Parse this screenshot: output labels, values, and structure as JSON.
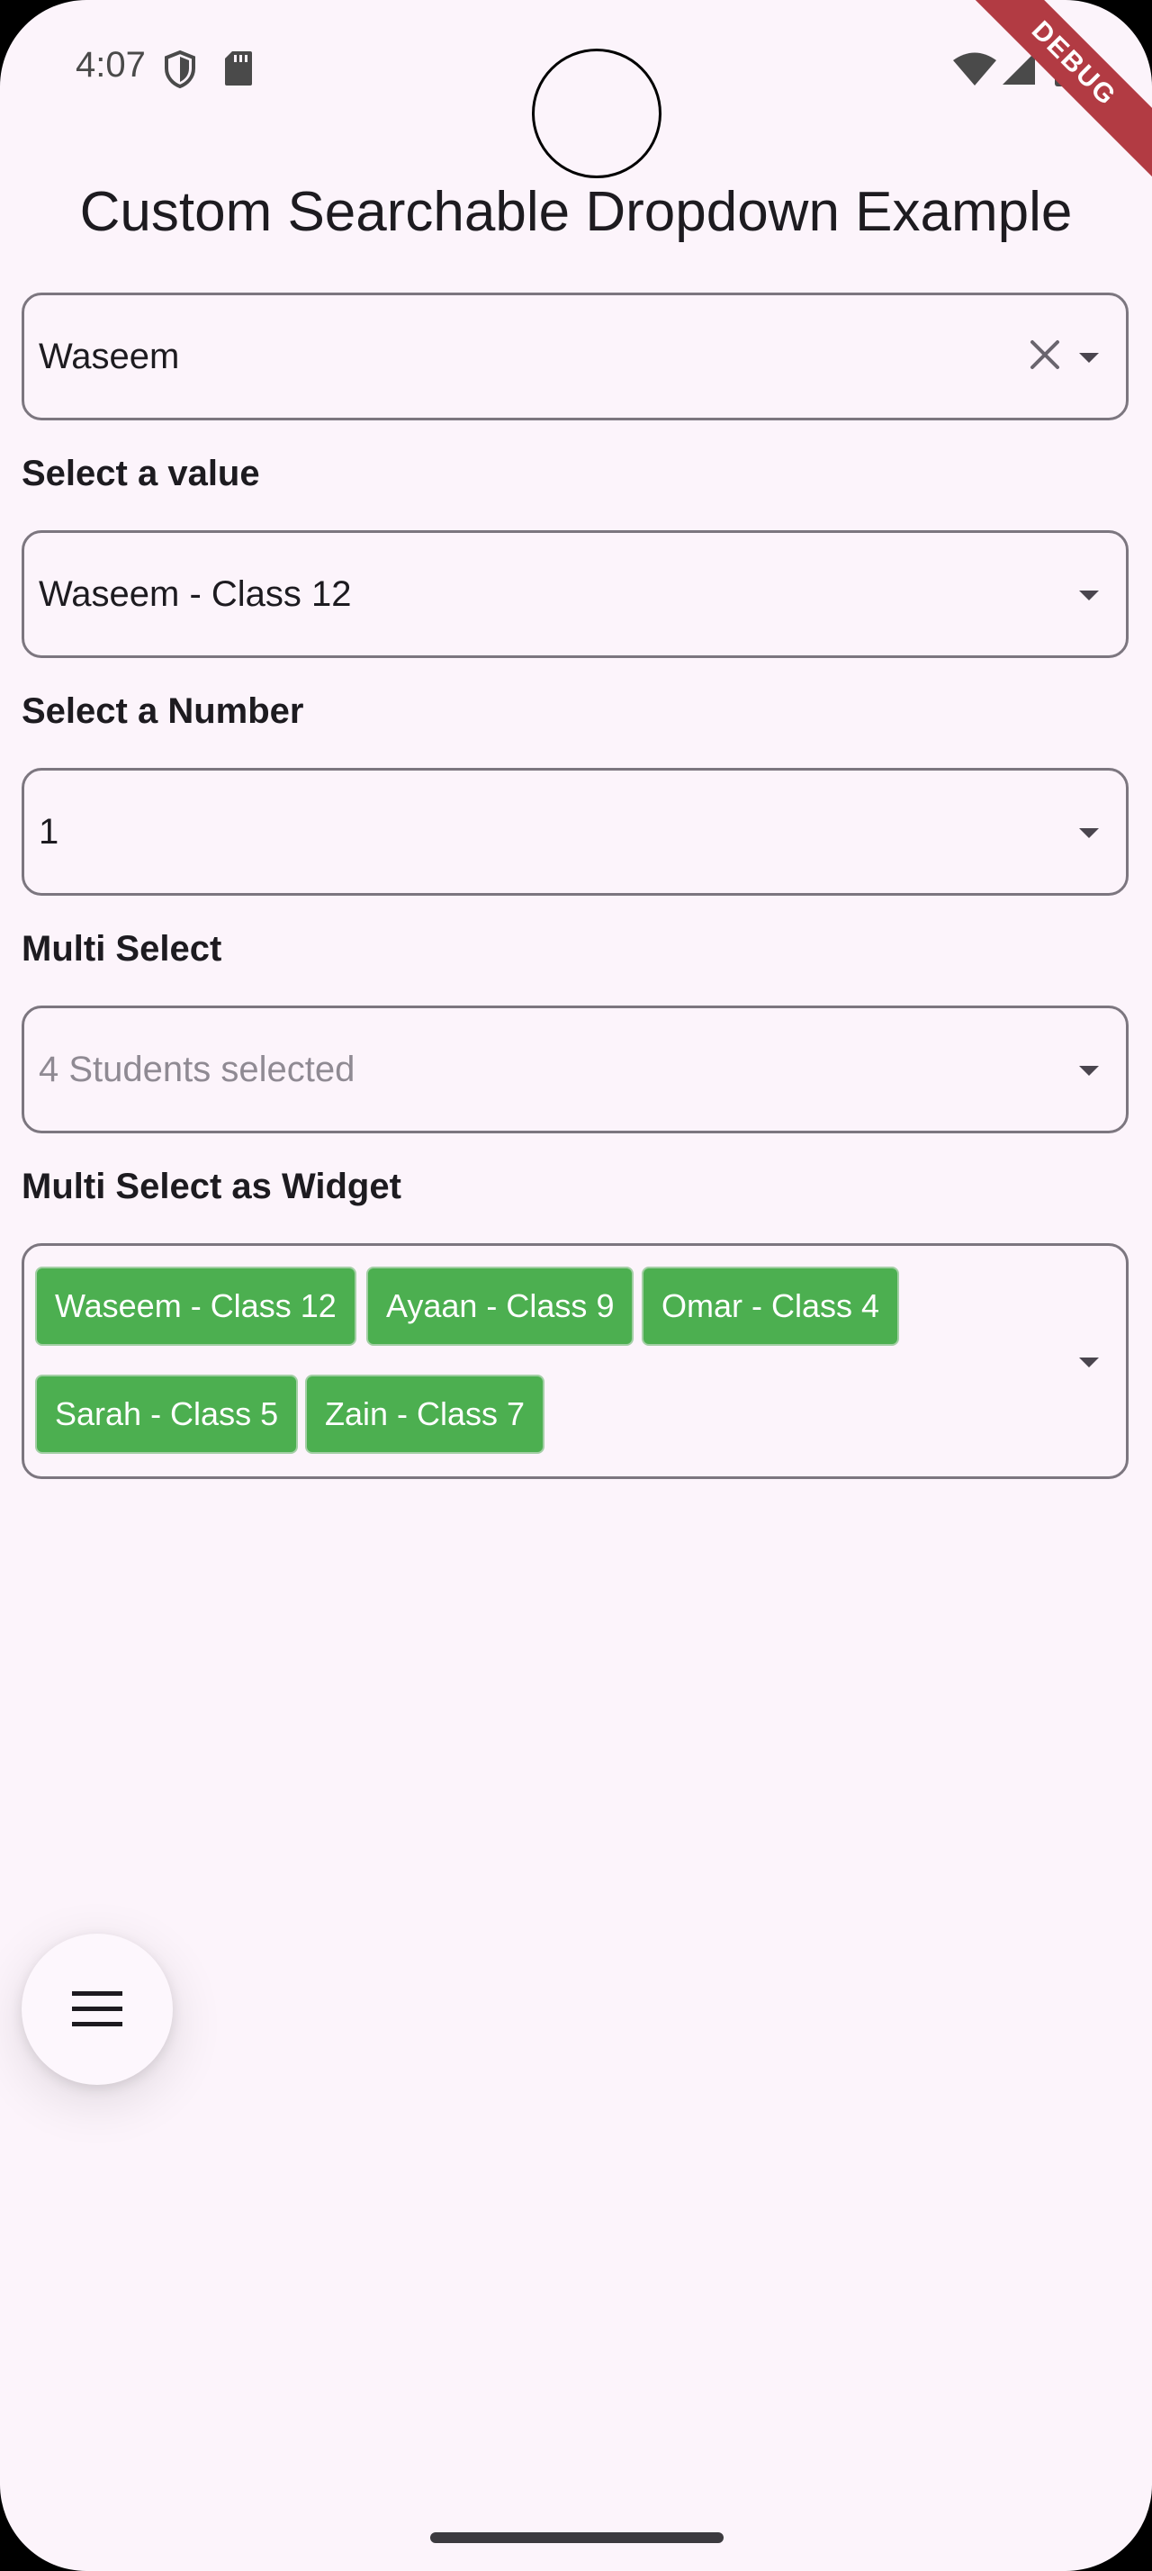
{
  "status_bar": {
    "time": "4:07",
    "debug_banner": "DEBUG"
  },
  "app": {
    "title": "Custom Searchable Dropdown Example"
  },
  "dropdowns": {
    "searchable": {
      "value": "Waseem"
    },
    "select_value": {
      "label": "Select a value",
      "value": "Waseem - Class 12"
    },
    "select_number": {
      "label": "Select a Number",
      "value": "1"
    },
    "multi_select": {
      "label": "Multi Select",
      "hint": "4 Students selected"
    },
    "multi_select_widget": {
      "label": "Multi Select as Widget",
      "chips": [
        "Waseem - Class 12",
        "Ayaan - Class 9",
        "Omar - Class 4",
        "Sarah - Class 5",
        "Zain - Class 7"
      ]
    }
  },
  "fab": {
    "icon": "menu-icon"
  },
  "colors": {
    "background": "#fcf4fb",
    "chip": "#4caf50",
    "border": "#7c767f",
    "debug_ribbon": "#b23b43"
  }
}
